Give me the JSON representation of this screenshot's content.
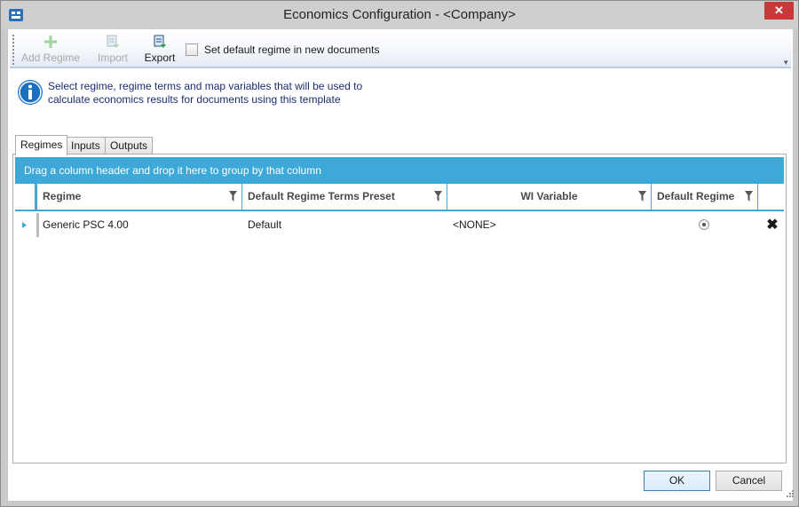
{
  "window": {
    "title": "Economics Configuration - <Company>",
    "close_glyph": "✕"
  },
  "toolbar": {
    "add_regime": "Add Regime",
    "import": "Import",
    "export": "Export",
    "set_default_label": "Set default regime in new documents",
    "set_default_checked": false
  },
  "info": {
    "line1": "Select regime, regime terms and map variables that will be used to",
    "line2": "calculate economics results for documents using this template"
  },
  "tabs": [
    {
      "label": "Regimes",
      "active": true
    },
    {
      "label": "Inputs",
      "active": false
    },
    {
      "label": "Outputs",
      "active": false
    }
  ],
  "grid": {
    "group_hint": "Drag a column header and drop it here to group by that column",
    "columns": [
      "Regime",
      "Default Regime Terms Preset",
      "WI Variable",
      "Default Regime"
    ],
    "rows": [
      {
        "regime": "Generic PSC 4.00",
        "preset": "Default",
        "wi_variable": "<NONE>",
        "default_regime": true
      }
    ],
    "delete_glyph": "✖"
  },
  "buttons": {
    "ok": "OK",
    "cancel": "Cancel"
  },
  "colors": {
    "accent": "#3ea9d8",
    "close_red": "#c73a3a",
    "info_blue": "#1a6fc0"
  },
  "icons": [
    "app-icon",
    "add-icon",
    "import-icon",
    "export-icon",
    "info-icon",
    "filter-icon",
    "row-indicator-icon",
    "delete-icon"
  ]
}
